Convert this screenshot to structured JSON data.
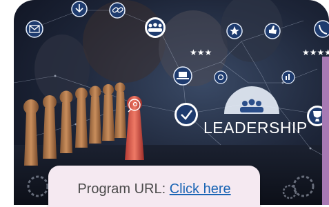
{
  "hero": {
    "caption": "LEADERSHIP"
  },
  "program": {
    "label": "Program URL:",
    "link_text": "Click here"
  },
  "icons": [
    "mail-icon",
    "download-icon",
    "link-icon",
    "group-icon",
    "star-icon",
    "thumbs-up-icon",
    "phone-icon",
    "laptop-icon",
    "settings-icon",
    "check-icon",
    "trophy-icon",
    "search-icon",
    "team-icon",
    "document-icon",
    "chart-icon",
    "gear-icon"
  ],
  "colors": {
    "accent": "#a879b4",
    "link": "#1a64b4",
    "panel": "#f5e9f1"
  }
}
